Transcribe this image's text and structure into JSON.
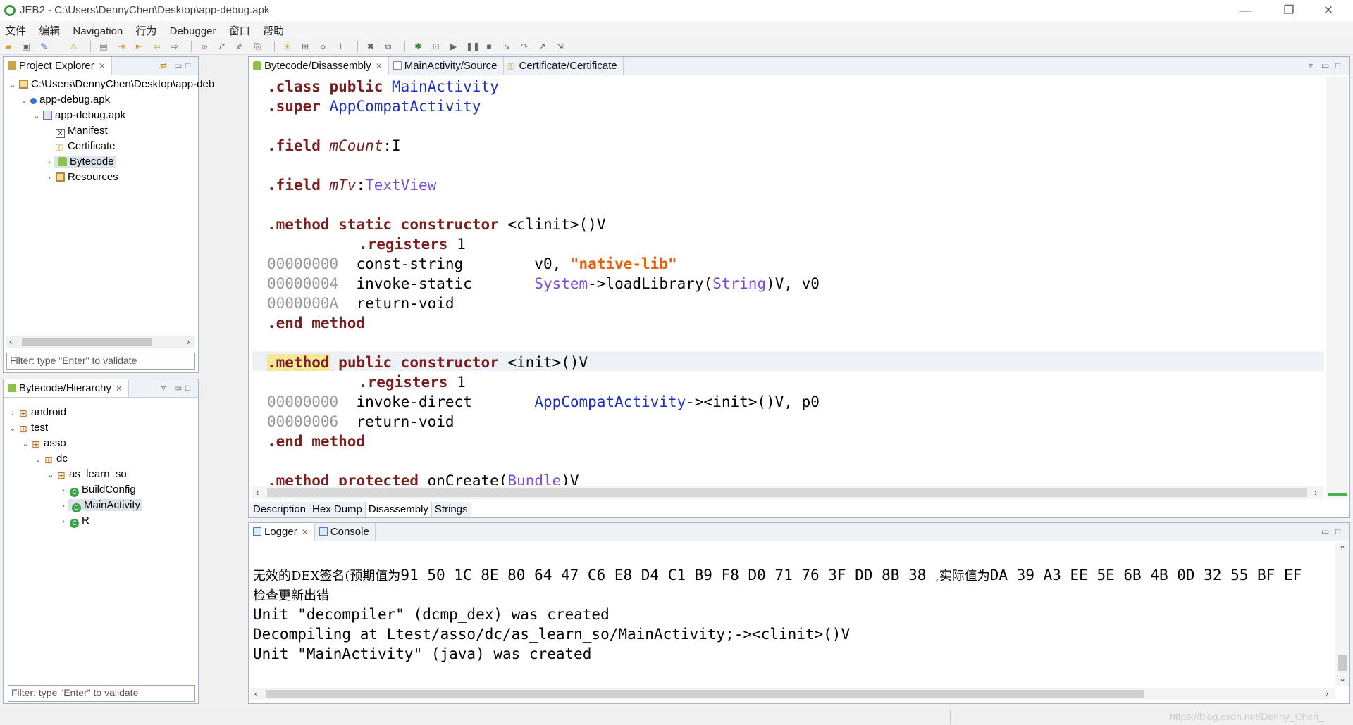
{
  "window": {
    "title": "JEB2 - C:\\Users\\DennyChen\\Desktop\\app-debug.apk",
    "minimize": "—",
    "restore": "❐",
    "close": "✕"
  },
  "menu": [
    "文件",
    "编辑",
    "Navigation",
    "行为",
    "Debugger",
    "窗口",
    "帮助"
  ],
  "project_explorer": {
    "tab": "Project Explorer",
    "nodes": [
      {
        "label": "C:\\Users\\DennyChen\\Desktop\\app-deb",
        "twisty": "⌄",
        "icon": "folder-icon"
      },
      {
        "label": "app-debug.apk",
        "twisty": "⌄",
        "icon": "artifact-icon"
      },
      {
        "label": "app-debug.apk",
        "twisty": "⌄",
        "icon": "apk-icon"
      },
      {
        "label": "Manifest",
        "twisty": "",
        "icon": "xml-icon"
      },
      {
        "label": "Certificate",
        "twisty": "",
        "icon": "key-icon"
      },
      {
        "label": "Bytecode",
        "twisty": "›",
        "icon": "android-icon"
      },
      {
        "label": "Resources",
        "twisty": "›",
        "icon": "folder-icon"
      }
    ],
    "filter_placeholder": "Filter: type \"Enter\" to validate"
  },
  "hierarchy": {
    "tab": "Bytecode/Hierarchy",
    "nodes": [
      {
        "label": "android",
        "twisty": "›"
      },
      {
        "label": "test",
        "twisty": "⌄"
      },
      {
        "label": "asso",
        "twisty": "⌄"
      },
      {
        "label": "dc",
        "twisty": "⌄"
      },
      {
        "label": "as_learn_so",
        "twisty": "⌄"
      },
      {
        "label": "BuildConfig",
        "twisty": "›"
      },
      {
        "label": "MainActivity",
        "twisty": "›"
      },
      {
        "label": "R",
        "twisty": "›"
      }
    ],
    "filter_placeholder": "Filter: type \"Enter\" to validate"
  },
  "editor": {
    "tabs": [
      "Bytecode/Disassembly",
      "MainActivity/Source",
      "Certificate/Certificate"
    ],
    "code": {
      "l1": [
        ".class",
        " public ",
        "MainActivity"
      ],
      "l2": [
        ".super",
        " ",
        "AppCompatActivity"
      ],
      "l4": [
        ".field",
        " ",
        "mCount",
        ":I"
      ],
      "l6": [
        ".field",
        " ",
        "mTv",
        ":",
        "TextView"
      ],
      "l8": [
        ".method",
        " ",
        "static constructor",
        " <clinit>()V"
      ],
      "l9": [
        ".registers",
        " 1"
      ],
      "l10": [
        "00000000",
        "  const-string        v0, ",
        "\"native-lib\""
      ],
      "l11": [
        "00000004",
        "  invoke-static       ",
        "System",
        "->loadLibrary(",
        "String",
        ")V, v0"
      ],
      "l12": [
        "0000000A",
        "  return-void"
      ],
      "l13": [
        ".end method"
      ],
      "l15": [
        ".method",
        " ",
        "public constructor",
        " <init>()V"
      ],
      "l16": [
        ".registers",
        " 1"
      ],
      "l17": [
        "00000000",
        "  invoke-direct       ",
        "AppCompatActivity",
        "-><init>()V, p0"
      ],
      "l18": [
        "00000006",
        "  return-void"
      ],
      "l19": [
        ".end method"
      ],
      "l21": [
        ".method",
        " ",
        "protected",
        " onCreate(",
        "Bundle",
        ")V"
      ]
    },
    "subtabs": [
      "Description",
      "Hex Dump",
      "Disassembly",
      "Strings"
    ]
  },
  "logger": {
    "tabs": [
      "Logger",
      "Console"
    ],
    "lines": [
      {
        "a": "无效的DEX签名(预期值为",
        "b": "91 50 1C 8E 80 64 47 C6 E8 D4 C1 B9 F8 D0 71 76 3F DD 8B 38 ",
        "c": ",实际值为",
        "d": "DA 39 A3 EE 5E 6B 4B 0D 32 55 BF EF"
      },
      {
        "a": "检查更新出错"
      },
      {
        "b": "Unit \"decompiler\" (dcmp_dex) was created"
      },
      {
        "b": "Decompiling at Ltest/asso/dc/as_learn_so/MainActivity;-><clinit>()V"
      },
      {
        "b": "Unit \"MainActivity\" (java) was created"
      }
    ]
  },
  "status": {
    "watermark": "https://blog.csdn.net/Denny_Chen_"
  },
  "colors": {
    "keyword": "#7a1f1f",
    "type": "#7a4cd8",
    "class_name": "#1f2fbf",
    "string": "#e8620a",
    "offset": "#999999"
  }
}
